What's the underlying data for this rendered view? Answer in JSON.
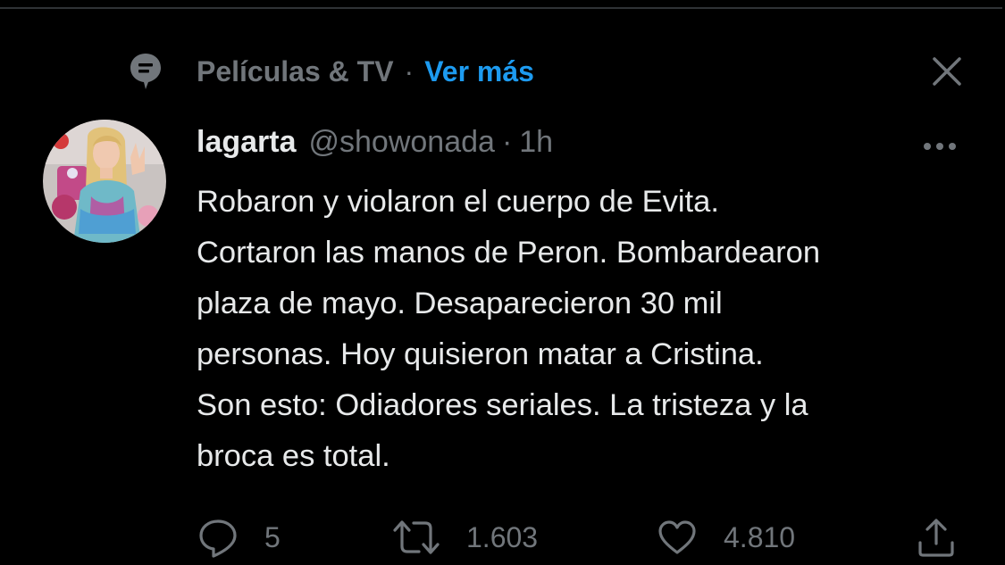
{
  "context": {
    "topic": "Películas & TV",
    "separator": "·",
    "see_more": "Ver más"
  },
  "tweet": {
    "display_name": "lagarta",
    "handle": "@showonada",
    "separator": "·",
    "time": "1h",
    "text_lines": [
      "Robaron y violaron el cuerpo de Evita.",
      "Cortaron las manos de Peron. Bombardearon",
      "plaza de mayo. Desaparecieron 30 mil",
      "personas. Hoy quisieron matar a Cristina.",
      "Son esto: Odiadores seriales. La tristeza y la",
      "broca es total."
    ]
  },
  "actions": {
    "replies": "5",
    "retweets": "1.603",
    "likes": "4.810"
  },
  "colors": {
    "background": "#000000",
    "text_primary": "#e7e9ea",
    "text_secondary": "#71767b",
    "accent": "#1d9bf0"
  },
  "icons": {
    "topic": "topic-bubble-icon",
    "close": "close-icon",
    "more": "more-icon",
    "reply": "reply-icon",
    "retweet": "retweet-icon",
    "like": "heart-icon",
    "share": "share-icon"
  }
}
